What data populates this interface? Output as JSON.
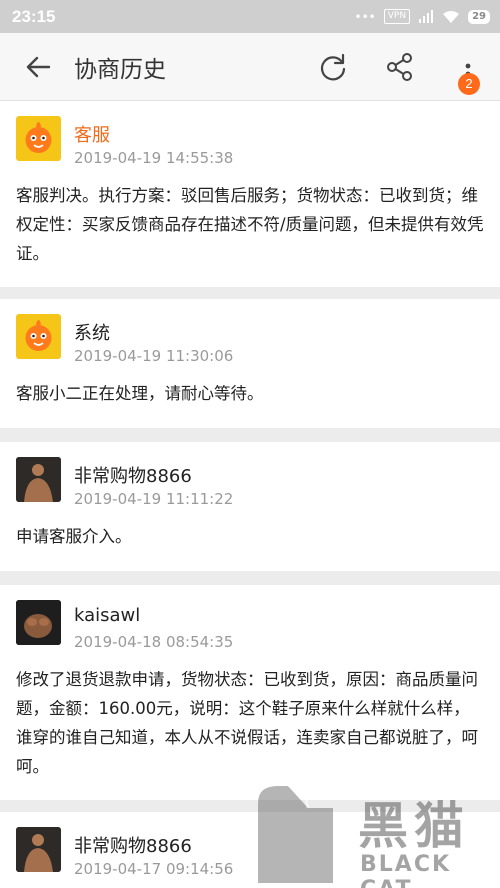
{
  "status_bar": {
    "time": "23:15",
    "signal_dots": "•••",
    "vpn": "VPN",
    "battery": "29"
  },
  "topbar": {
    "title": "协商历史",
    "badge": "2"
  },
  "entries": [
    {
      "name": "客服",
      "time": "2019-04-19 14:55:38",
      "text": "客服判决。执行方案：驳回售后服务；货物状态：已收到货；维权定性：买家反馈商品存在描述不符/质量问题，但未提供有效凭证。"
    },
    {
      "name": "系统",
      "time": "2019-04-19 11:30:06",
      "text": "客服小二正在处理，请耐心等待。"
    },
    {
      "name": "非常购物8866",
      "time": "2019-04-19 11:11:22",
      "text": "申请客服介入。"
    },
    {
      "name": "kaisawl",
      "time": "2019-04-18 08:54:35",
      "text": "修改了退货退款申请，货物状态：已收到货，原因：商品质量问题，金额：160.00元，说明：这个鞋子原来什么样就什么样，谁穿的谁自己知道，本人从不说假话，连卖家自己都说脏了，呵呵。"
    },
    {
      "name": "非常购物8866",
      "time": "2019-04-17 09:14:56",
      "text": ""
    }
  ],
  "watermark": {
    "cn": "黑猫",
    "en": "BLACK CAT"
  },
  "colors": {
    "accent": "#ff6a1a",
    "service_name": "#f26b1d",
    "background": "#ececec"
  },
  "icons": [
    "back-arrow-icon",
    "refresh-icon",
    "share-icon",
    "more-vertical-icon"
  ]
}
